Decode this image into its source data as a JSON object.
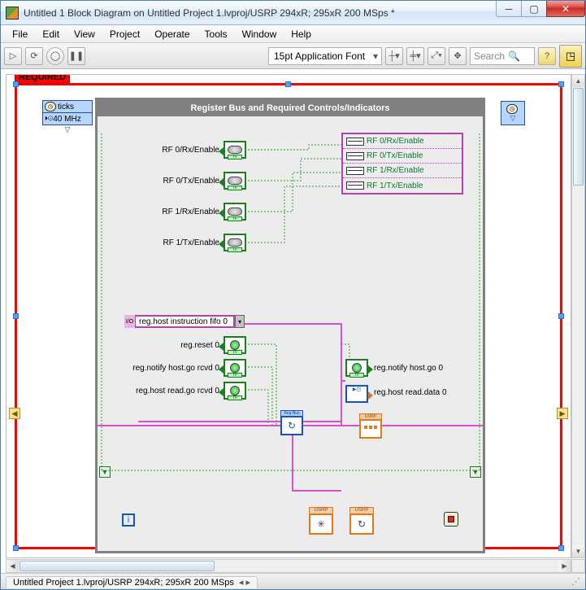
{
  "window": {
    "title": "Untitled 1 Block Diagram on Untitled Project 1.lvproj/USRP 294xR; 295xR 200 MSps *"
  },
  "menu": {
    "file": "File",
    "edit": "Edit",
    "view": "View",
    "project": "Project",
    "operate": "Operate",
    "tools": "Tools",
    "window": "Window",
    "help": "Help"
  },
  "toolbar": {
    "font": "15pt Application Font",
    "search_placeholder": "Search"
  },
  "required_label": "REQUIRED",
  "ticks": {
    "label": "ticks",
    "clock": "40 MHz"
  },
  "panel": {
    "title": "Register Bus and Required Controls/Indicators",
    "rf_labels": [
      "RF 0/Rx/Enable",
      "RF 0/Tx/Enable",
      "RF 1/Rx/Enable",
      "RF 1/Tx/Enable"
    ],
    "indicator_labels": [
      "RF 0/Rx/Enable",
      "RF 0/Tx/Enable",
      "RF 1/Rx/Enable",
      "RF 1/Tx/Enable"
    ],
    "fifo": "reg.host instruction fifo 0",
    "reg_labels": {
      "reset": "reg.reset 0",
      "notify_go": "reg.notify host.go rcvd 0",
      "read_go": "reg.host read.go rcvd 0",
      "notify_out": "reg.notify host.go 0",
      "read_data": "reg.host read.data 0"
    },
    "regbus": "Reg Bus",
    "usrp": "USRP"
  },
  "status": {
    "tab": "Untitled Project 1.lvproj/USRP 294xR; 295xR 200 MSps"
  }
}
